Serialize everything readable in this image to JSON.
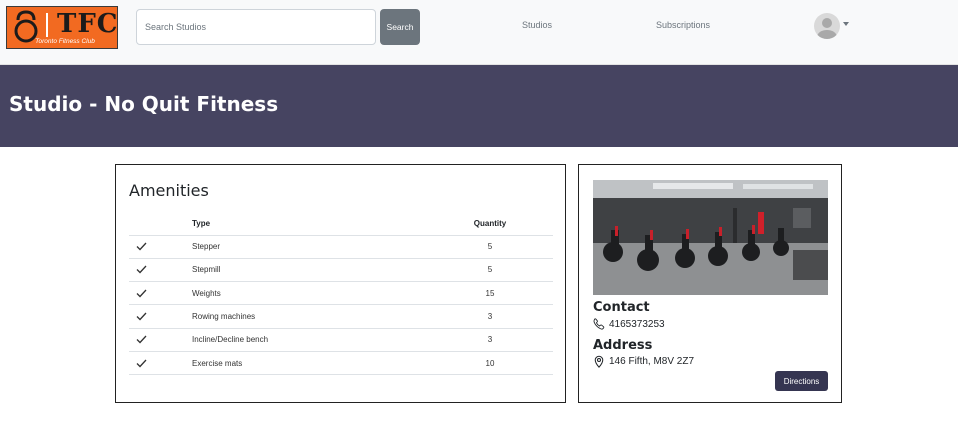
{
  "navbar": {
    "logo": {
      "mark": "TFC",
      "tagline": "Toronto Fitness Club"
    },
    "search": {
      "placeholder": "Search Studios",
      "value": "",
      "button_label": "Search"
    },
    "links": [
      {
        "label": "Studios"
      },
      {
        "label": "Subscriptions"
      }
    ]
  },
  "page": {
    "title": "Studio - No Quit Fitness"
  },
  "amenities": {
    "title": "Amenities",
    "columns": {
      "type": "Type",
      "quantity": "Quantity"
    },
    "rows": [
      {
        "type": "Stepper",
        "quantity": "5"
      },
      {
        "type": "Stepmill",
        "quantity": "5"
      },
      {
        "type": "Weights",
        "quantity": "15"
      },
      {
        "type": "Rowing machines",
        "quantity": "3"
      },
      {
        "type": "Incline/Decline bench",
        "quantity": "3"
      },
      {
        "type": "Exercise mats",
        "quantity": "10"
      }
    ]
  },
  "studio": {
    "contact_title": "Contact",
    "phone": "4165373253",
    "address_title": "Address",
    "address": "146 Fifth, M8V 2Z7",
    "directions_label": "Directions"
  },
  "colors": {
    "banner": "#464461",
    "logo": "#f26a21",
    "button": "#353551",
    "search_button": "#6c757d"
  },
  "icons": {
    "check": "check-icon",
    "phone": "phone-icon",
    "location": "map-pin-icon",
    "avatar": "user-avatar-icon"
  }
}
